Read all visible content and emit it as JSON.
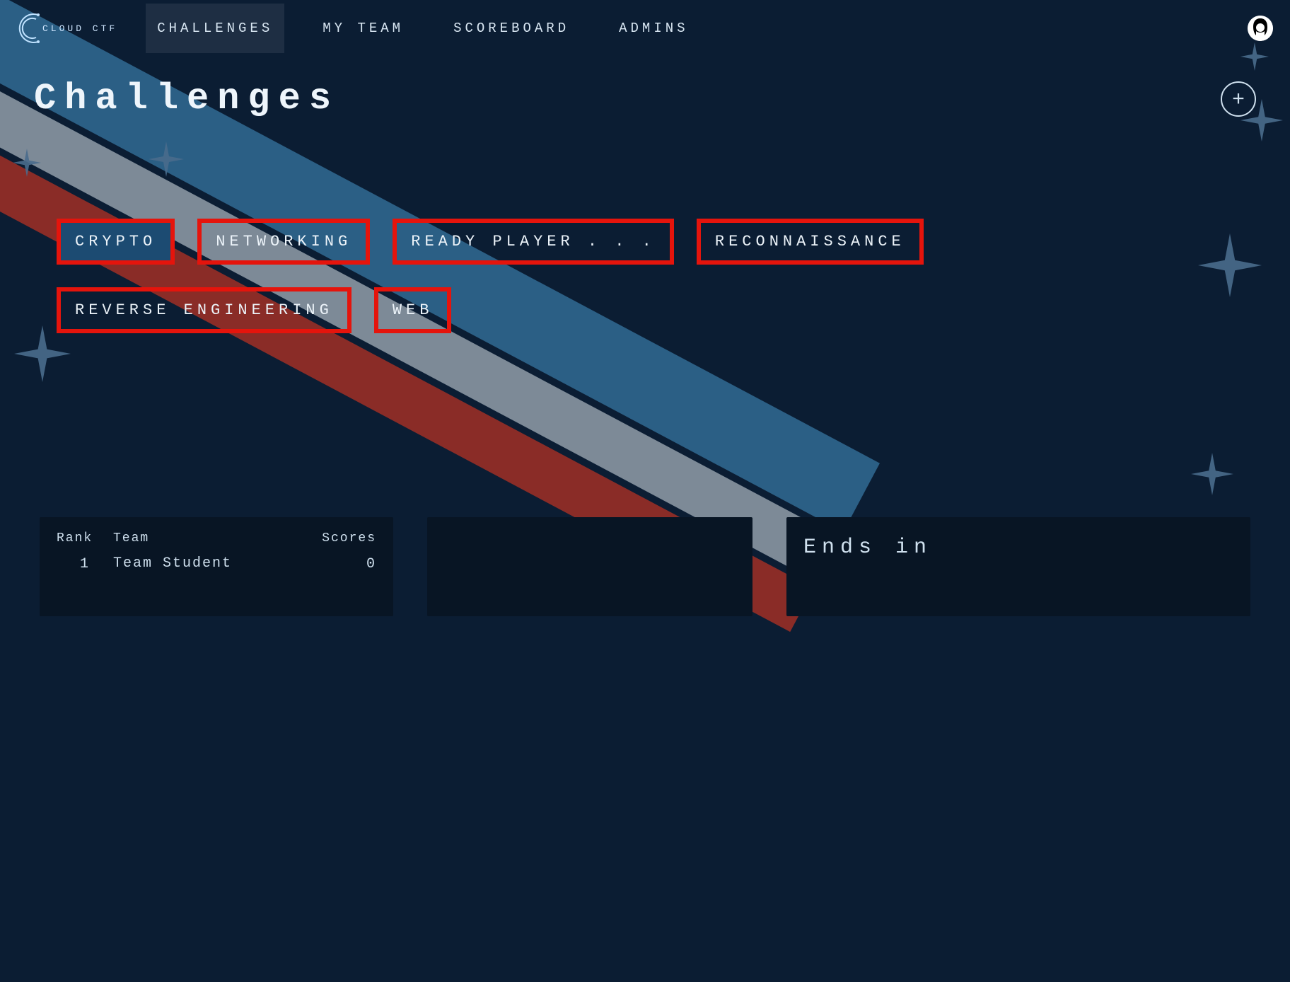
{
  "brand": {
    "name": "CLOUD CTF"
  },
  "nav": {
    "items": [
      {
        "label": "CHALLENGES",
        "active": true
      },
      {
        "label": "MY TEAM",
        "active": false
      },
      {
        "label": "SCOREBOARD",
        "active": false
      },
      {
        "label": "ADMINS",
        "active": false
      }
    ]
  },
  "page": {
    "title": "Challenges",
    "add_icon": "+"
  },
  "categories": [
    {
      "label": "CRYPTO",
      "active": true
    },
    {
      "label": "NETWORKING",
      "active": false
    },
    {
      "label": "READY PLAYER . . .",
      "active": false
    },
    {
      "label": "RECONNAISSANCE",
      "active": false
    },
    {
      "label": "REVERSE ENGINEERING",
      "active": false
    },
    {
      "label": "WEB",
      "active": false
    }
  ],
  "scoreboard": {
    "headers": {
      "rank": "Rank",
      "team": "Team",
      "scores": "Scores"
    },
    "rows": [
      {
        "rank": "1",
        "team": "Team Student",
        "score": "0"
      }
    ]
  },
  "timer": {
    "label": "Ends in"
  }
}
